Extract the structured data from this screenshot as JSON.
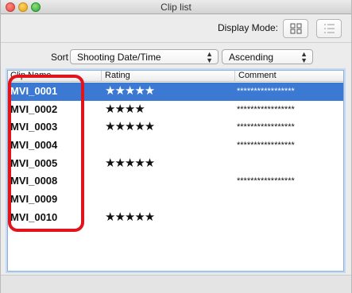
{
  "window": {
    "title": "Clip list"
  },
  "toolbar": {
    "display_mode_label": "Display Mode:"
  },
  "sort": {
    "label": "Sort",
    "field_value": "Shooting Date/Time",
    "order_value": "Ascending"
  },
  "table": {
    "columns": [
      "Clip Name",
      "Rating",
      "Comment"
    ],
    "rows": [
      {
        "name": "MVI_0001",
        "rating": "★★★★★",
        "comment": "*****************",
        "selected": true
      },
      {
        "name": "MVI_0002",
        "rating": "★★★★",
        "comment": "*****************"
      },
      {
        "name": "MVI_0003",
        "rating": "★★★★★",
        "comment": "*****************"
      },
      {
        "name": "MVI_0004",
        "rating": "",
        "comment": "*****************"
      },
      {
        "name": "MVI_0005",
        "rating": "★★★★★",
        "comment": ""
      },
      {
        "name": "MVI_0008",
        "rating": "",
        "comment": "*****************"
      },
      {
        "name": "MVI_0009",
        "rating": "",
        "comment": ""
      },
      {
        "name": "MVI_0010",
        "rating": "★★★★★",
        "comment": ""
      }
    ]
  },
  "colors": {
    "selection": "#3b79d2",
    "highlight_outline": "#e2131b"
  },
  "icons": {
    "display_grid": "grid-view-icon",
    "display_list": "list-view-icon"
  }
}
